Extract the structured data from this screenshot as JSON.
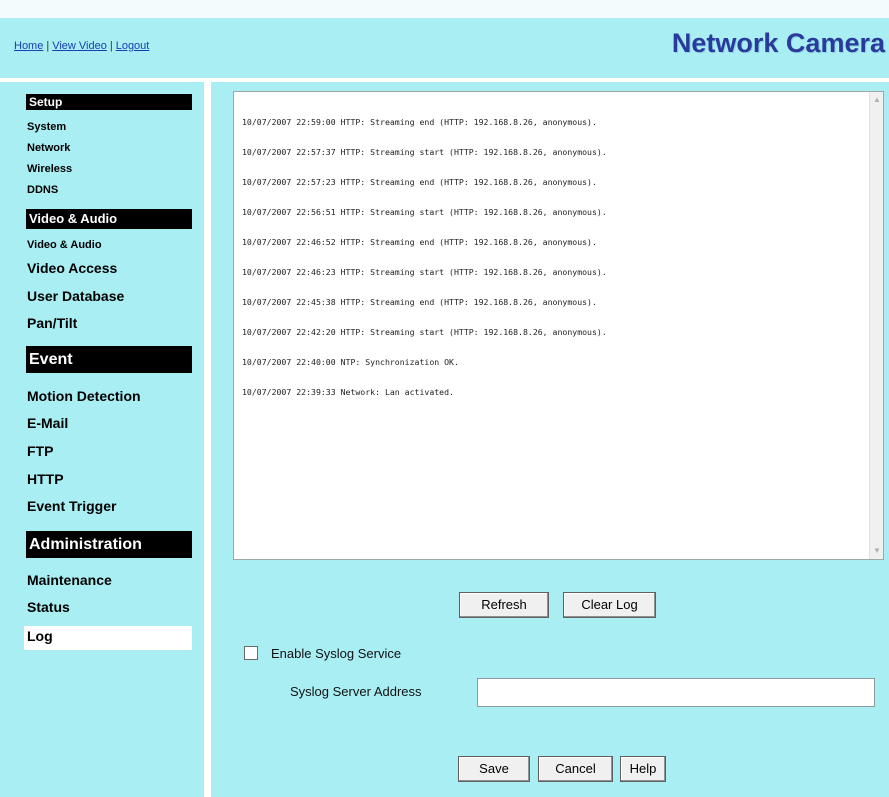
{
  "header": {
    "links": [
      "Home",
      "View Video",
      "Logout"
    ],
    "separator": "|",
    "brand": "Network Camera"
  },
  "sidebar": {
    "sections": [
      {
        "title": "Setup",
        "items": [
          "System",
          "Network",
          "Wireless",
          "DDNS"
        ]
      },
      {
        "title": "Video & Audio",
        "items": [
          "Video & Audio",
          "Video Access",
          "User Database",
          "Pan/Tilt"
        ]
      },
      {
        "title": "Event",
        "items": [
          "Motion Detection",
          "E-Mail",
          "FTP",
          "HTTP",
          "Event Trigger"
        ]
      },
      {
        "title": "Administration",
        "items": [
          "Maintenance",
          "Status",
          "Log"
        ]
      }
    ],
    "active_item": "Log"
  },
  "log": {
    "lines": [
      "10/07/2007 22:59:00 HTTP: Streaming end (HTTP: 192.168.8.26, anonymous).",
      "10/07/2007 22:57:37 HTTP: Streaming start (HTTP: 192.168.8.26, anonymous).",
      "10/07/2007 22:57:23 HTTP: Streaming end (HTTP: 192.168.8.26, anonymous).",
      "10/07/2007 22:56:51 HTTP: Streaming start (HTTP: 192.168.8.26, anonymous).",
      "10/07/2007 22:46:52 HTTP: Streaming end (HTTP: 192.168.8.26, anonymous).",
      "10/07/2007 22:46:23 HTTP: Streaming start (HTTP: 192.168.8.26, anonymous).",
      "10/07/2007 22:45:38 HTTP: Streaming end (HTTP: 192.168.8.26, anonymous).",
      "10/07/2007 22:42:20 HTTP: Streaming start (HTTP: 192.168.8.26, anonymous).",
      "10/07/2007 22:40:00 NTP: Synchronization OK.",
      "10/07/2007 22:39:33 Network: Lan activated."
    ]
  },
  "buttons": {
    "refresh": "Refresh",
    "clear_log": "Clear Log",
    "save": "Save",
    "cancel": "Cancel",
    "help": "Help"
  },
  "syslog": {
    "enable_label": "Enable Syslog Service",
    "enabled": false,
    "server_label": "Syslog Server Address",
    "server_value": ""
  },
  "colors": {
    "background": "#a8eef3",
    "section_header": "#000000",
    "brand": "#2a3a9c",
    "link": "#1a3fb0"
  }
}
